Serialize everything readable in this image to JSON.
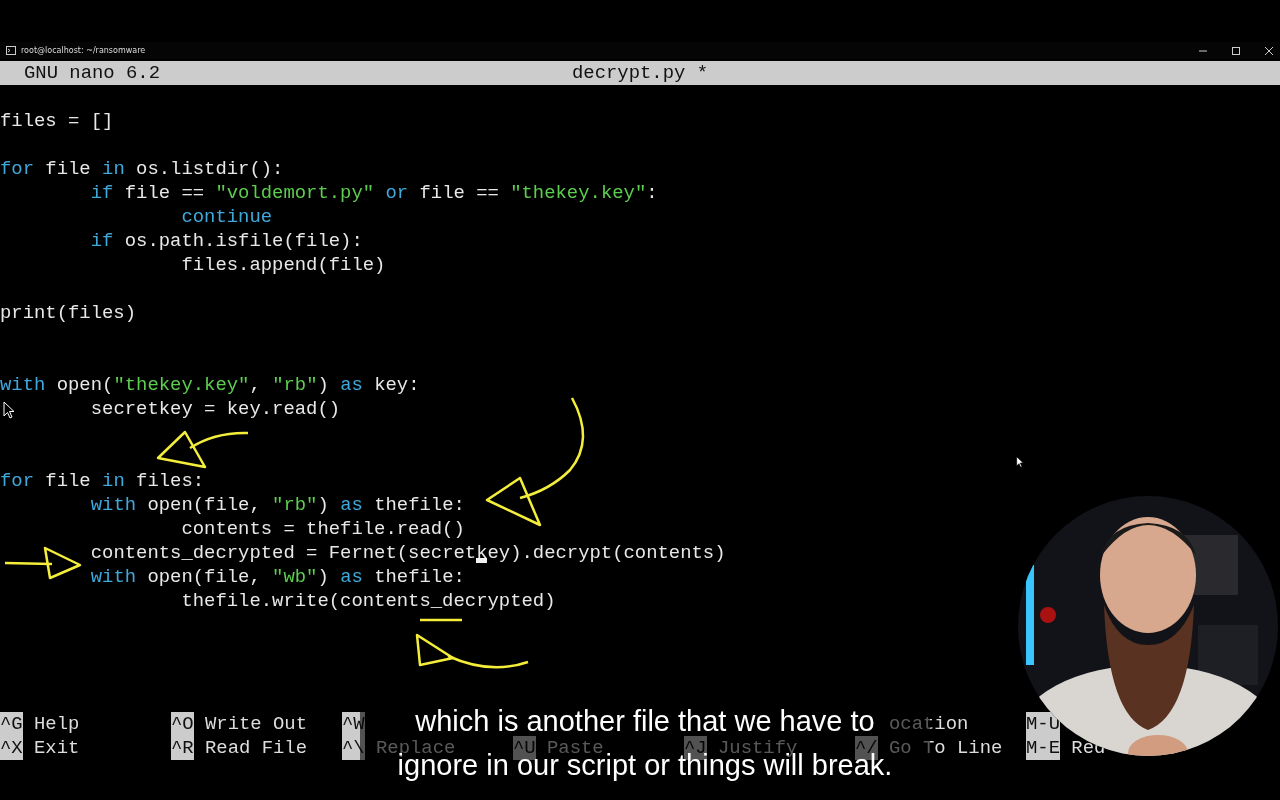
{
  "window": {
    "title": "root@localhost: ~/ransomware"
  },
  "nano": {
    "version": "GNU nano 6.2",
    "filename": "decrypt.py *"
  },
  "code": {
    "lines": [
      {
        "kind": "code",
        "tokens": [
          {
            "text": "files = []",
            "kind": "plain"
          }
        ]
      },
      {
        "kind": "blank"
      },
      {
        "kind": "code",
        "tokens": [
          {
            "text": "for",
            "kind": "keyword"
          },
          {
            "text": " file ",
            "kind": "plain"
          },
          {
            "text": "in",
            "kind": "keyword"
          },
          {
            "text": " os.listdir():",
            "kind": "plain"
          }
        ]
      },
      {
        "kind": "code",
        "tokens": [
          {
            "text": "        if",
            "kind": "keyword"
          },
          {
            "text": " file == ",
            "kind": "plain"
          },
          {
            "text": "\"voldemort.py\"",
            "kind": "string"
          },
          {
            "text": " or",
            "kind": "keyword"
          },
          {
            "text": " file == ",
            "kind": "plain"
          },
          {
            "text": "\"thekey.key\"",
            "kind": "string"
          },
          {
            "text": ":",
            "kind": "plain"
          }
        ]
      },
      {
        "kind": "code",
        "tokens": [
          {
            "text": "                continue",
            "kind": "keyword"
          }
        ]
      },
      {
        "kind": "code",
        "tokens": [
          {
            "text": "        if",
            "kind": "keyword"
          },
          {
            "text": " os.path.isfile(file):",
            "kind": "plain"
          }
        ]
      },
      {
        "kind": "code",
        "tokens": [
          {
            "text": "                files.append(file)",
            "kind": "plain"
          }
        ]
      },
      {
        "kind": "blank"
      },
      {
        "kind": "code",
        "tokens": [
          {
            "text": "print(files)",
            "kind": "plain"
          }
        ]
      },
      {
        "kind": "blank"
      },
      {
        "kind": "blank"
      },
      {
        "kind": "code",
        "tokens": [
          {
            "text": "with",
            "kind": "keyword"
          },
          {
            "text": " open(",
            "kind": "plain"
          },
          {
            "text": "\"thekey.key\"",
            "kind": "string"
          },
          {
            "text": ", ",
            "kind": "plain"
          },
          {
            "text": "\"rb\"",
            "kind": "string"
          },
          {
            "text": ") ",
            "kind": "plain"
          },
          {
            "text": "as",
            "kind": "keyword"
          },
          {
            "text": " key:",
            "kind": "plain"
          }
        ]
      },
      {
        "kind": "code",
        "tokens": [
          {
            "text": "        secretkey = key.read()",
            "kind": "plain"
          }
        ]
      },
      {
        "kind": "blank"
      },
      {
        "kind": "blank"
      },
      {
        "kind": "code",
        "tokens": [
          {
            "text": "for",
            "kind": "keyword"
          },
          {
            "text": " file ",
            "kind": "plain"
          },
          {
            "text": "in",
            "kind": "keyword"
          },
          {
            "text": " files:",
            "kind": "plain"
          }
        ]
      },
      {
        "kind": "code",
        "tokens": [
          {
            "text": "        with",
            "kind": "keyword"
          },
          {
            "text": " open(file, ",
            "kind": "plain"
          },
          {
            "text": "\"rb\"",
            "kind": "string"
          },
          {
            "text": ") ",
            "kind": "plain"
          },
          {
            "text": "as",
            "kind": "keyword"
          },
          {
            "text": " thefile:",
            "kind": "plain"
          }
        ]
      },
      {
        "kind": "code",
        "tokens": [
          {
            "text": "                contents = thefile.read()",
            "kind": "plain"
          }
        ]
      },
      {
        "kind": "code",
        "tokens": [
          {
            "text": "        contents_decrypted = Fernet(secret",
            "kind": "plain"
          },
          {
            "text": "k",
            "kind": "plain",
            "cursor": true
          },
          {
            "text": "ey).decrypt(contents)",
            "kind": "plain"
          }
        ]
      },
      {
        "kind": "code",
        "tokens": [
          {
            "text": "        with",
            "kind": "keyword"
          },
          {
            "text": " open(file, ",
            "kind": "plain"
          },
          {
            "text": "\"wb\"",
            "kind": "string"
          },
          {
            "text": ") ",
            "kind": "plain"
          },
          {
            "text": "as",
            "kind": "keyword"
          },
          {
            "text": " thefile:",
            "kind": "plain"
          }
        ]
      },
      {
        "kind": "code",
        "tokens": [
          {
            "text": "                thefile.write(contents_decrypted)",
            "kind": "plain"
          }
        ]
      }
    ]
  },
  "shortcuts": {
    "rows": [
      [
        {
          "key": "^G",
          "label": "Help"
        },
        {
          "key": "^O",
          "label": "Write Out"
        },
        {
          "key": "^W"
        },
        {},
        {},
        {
          "label": "ocation"
        },
        {
          "key": "M-U"
        }
      ],
      [
        {
          "key": "^X",
          "label": "Exit"
        },
        {
          "key": "^R",
          "label": "Read File"
        },
        {
          "key": "^\\",
          "label": "Replace"
        },
        {
          "key": "^U",
          "label": "Paste"
        },
        {
          "key": "^J",
          "label": "Justify"
        },
        {
          "key": "^/",
          "label": "Go To Line"
        },
        {
          "key": "M-E",
          "label": "Red"
        }
      ]
    ]
  },
  "subtitle": {
    "lines": [
      "which is another file that we have to",
      "ignore in our script or things will break."
    ]
  }
}
